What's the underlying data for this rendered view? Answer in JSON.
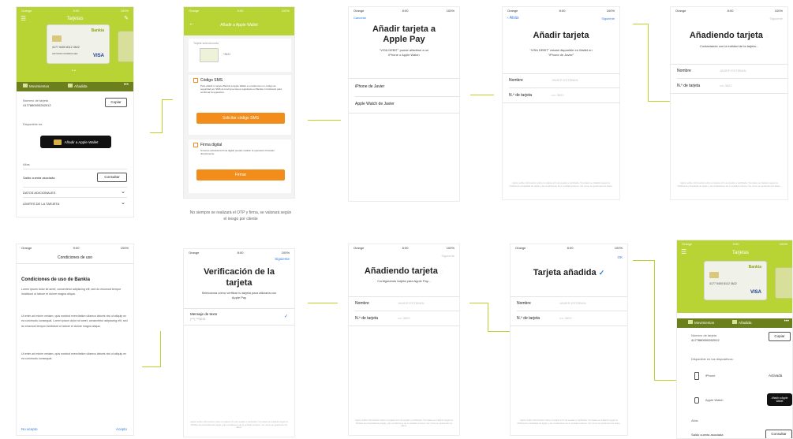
{
  "flow_connector_color": "#bfd630",
  "accent_green": "#b7d334",
  "accent_orange": "#f28c1b",
  "ios_blue": "#2f7de1",
  "status": {
    "carrier": "Orange",
    "carrier_short": "Orange",
    "time_a": "9:00",
    "time_b": "8:00",
    "battery": "100%"
  },
  "s1": {
    "title": "Tarjetas",
    "bank": "Bankia",
    "card_number": "4177 5400 8112 3622",
    "card_name": "ANTONIO RODRIGUEZ",
    "brand": "VISA",
    "tab_movements": "Movimientos",
    "tab_added": "Añadida",
    "more": "•••",
    "card_number_label": "Número de tarjeta",
    "card_number_value": "4177880000262012",
    "copy": "Copiar",
    "available": "Disponible en:",
    "wallet_btn": "Añadir a Apple Wallet",
    "alias": "Alias",
    "balance": "Saldo cuenta asociada",
    "consult": "Consultar",
    "extra_data": "DATOS ADICIONALES",
    "limits": "LÍMITES DE LA TARJETA"
  },
  "s2": {
    "title": "Añadir a Apple Wallet",
    "back": "←",
    "card_caption": "Tarjeta seleccionada",
    "card_digits": "*3622",
    "sms_title": "Código SMS",
    "sms_text": "Para añadir tu tarjeta Bankia a Apple Wallet te enviaremos un código de seguridad por SMS al móvil que tienes registrado en Bankia. Introdúcelo para confirmar la operación.",
    "sms_button": "Solicitar código SMS",
    "sign_title": "Firma digital",
    "sign_text": "Si tienes activada la firma digital puedes realizar la operación firmando directamente.",
    "sign_button": "Firmar",
    "note": "No siempre se realizará el OTP y firma, se valorará según el riesgo por cliente"
  },
  "s3": {
    "cancel": "Cancelar",
    "title": "Añadir tarjeta a Apple Pay",
    "subtitle": "\"VISA DEBIT\" puede añadirse a un iPhone o Apple Watch",
    "opt1": "iPhone de Javier",
    "opt2": "Apple Watch de Javier"
  },
  "s4": {
    "back": "Atrás",
    "next": "Siguiente",
    "title": "Añadir tarjeta",
    "subtitle": "\"VISA DEBIT\" estará disponible en Wallet en \"iPhone de Javier\"",
    "name_label": "Nombre",
    "name_value": "JAVIER ESTEBAN",
    "card_label": "N.º de tarjeta",
    "card_value": "•••• 3622",
    "legal": "Apple recibe información sobre tu tarjeta a fin de ayudar a verificarla. Tus datos se tratarán según la Política de privacidad de Apple y las condiciones de tu entidad emisora. Ver cómo se gestionan los datos."
  },
  "s5": {
    "next": "Siguiente",
    "title": "Añadiendo tarjeta",
    "subtitle": "Contactando con la entidad de la tarjeta...",
    "name_label": "Nombre",
    "name_value": "JAVIER ESTEBAN",
    "card_label": "N.º de tarjeta",
    "card_value": "•••• 3622"
  },
  "s6": {
    "title": "Condiciones de uso",
    "heading": "Condiciones de uso de Bankia",
    "para1": "Lorem ipsum dolor sit amet, consectetur adipiscing elit, sed do eiusmod tempor incididunt ut labore et dolore magna aliqua.",
    "para2": "Ut enim ad minim veniam, quis nostrud exercitation ullamco laboris nisi ut aliquip ex ea commodo consequat. Lorem ipsum dolor sit amet, consectetur adipiscing elit, sed do eiusmod tempor incididunt ut labore et dolore magna aliqua.",
    "para3": "Ut enim ad minim veniam, quis nostrud exercitation ullamco laboris nisi ut aliquip ex ea commodo consequat.",
    "decline": "No acepto",
    "accept": "Acepto"
  },
  "s7": {
    "next": "Siguiente",
    "title": "Verificación de la tarjeta",
    "subtitle": "Selecciona cómo verificar tu tarjeta para utilizarla con Apple Pay",
    "option": "Mensaje de texto",
    "option_sub": "(***) ***0015"
  },
  "s8": {
    "next": "Siguiente",
    "title": "Añadiendo tarjeta",
    "subtitle": "Configurando tarjeta para Apple Pay...",
    "name_label": "Nombre",
    "name_value": "JAVIER ESTEBAN",
    "card_label": "N.º de tarjeta",
    "card_value": "•••• 3622"
  },
  "s9": {
    "ok": "OK",
    "title": "Tarjeta añadida",
    "name_label": "Nombre",
    "name_value": "JAVIER ESTEBAN",
    "card_label": "N.º de tarjeta",
    "card_value": "•••• 3622"
  },
  "s10": {
    "title": "Tarjetas",
    "bank": "Bankia",
    "card_number": "4177 5400 8112 3622",
    "tab_movements": "Movimientos",
    "tab_added": "Añadida",
    "card_number_label": "Número de tarjeta",
    "card_number_value": "4177880000262012",
    "copy": "Copiar",
    "available": "Disponible en tus dispositivos:",
    "iphone": "iPhone",
    "activated": "Activada",
    "watch": "Apple Watch",
    "watch_btn": "Añadir a Apple Wallet",
    "alias": "Alias",
    "balance": "Saldo cuenta asociada",
    "consult": "Consultar"
  }
}
